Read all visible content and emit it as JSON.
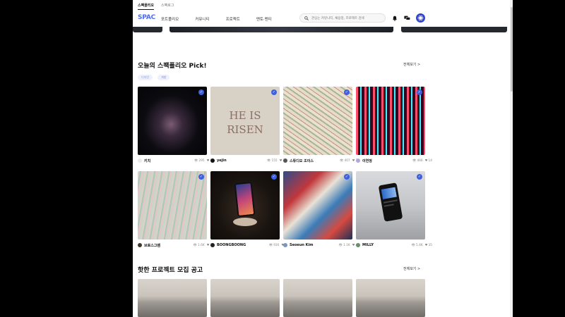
{
  "site_tabs": [
    "스팩폴리오",
    "스팩로그"
  ],
  "logo": "SPAC",
  "nav": [
    "포트폴리오",
    "커뮤니티",
    "프로젝트",
    "멘토·멘티"
  ],
  "search": {
    "placeholder": "관심는 커뮤니티, 채용정, 프로젝트 검색"
  },
  "icons": {
    "search": "search-icon",
    "bell": "bell-icon",
    "chat": "chat-icon",
    "avatar": "user-avatar"
  },
  "pick_section": {
    "title": "오늘의 스팩폴리오 Pick!",
    "view_all": "전체보기 >",
    "chips": [
      "디자인",
      "개발"
    ],
    "cards": [
      {
        "name": "키치",
        "views": "295",
        "likes": "10"
      },
      {
        "name": "yejin",
        "views": "155",
        "likes": "33"
      },
      {
        "name": "스튜디오 조이스",
        "views": "407",
        "likes": "25"
      },
      {
        "name": "이연정",
        "views": "466",
        "likes": "14"
      },
      {
        "name": "브로스그램",
        "views": "1.6K",
        "likes": "22"
      },
      {
        "name": "BOONGBOONG",
        "views": "930",
        "likes": "8"
      },
      {
        "name": "Seoeun Kim",
        "views": "1.1K",
        "likes": "45"
      },
      {
        "name": "MILLY",
        "views": "5.4K",
        "likes": "35"
      }
    ]
  },
  "recruit_section": {
    "title": "핫한 프로젝트 모집 공고",
    "view_all": "전체보기 >"
  },
  "colors": {
    "accent": "#3d5fe0",
    "chip_bg": "#eef1fb"
  }
}
